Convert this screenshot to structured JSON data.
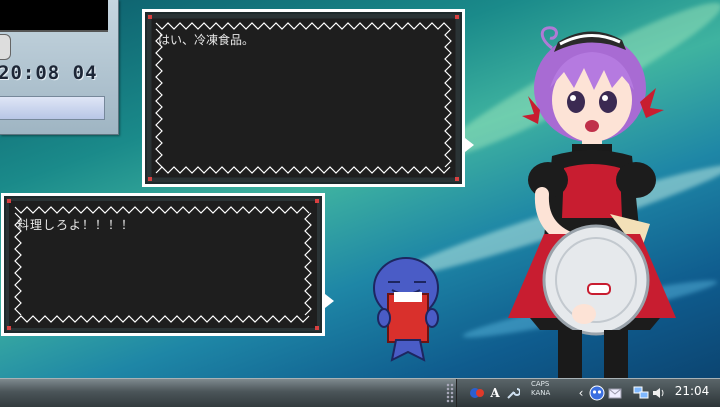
{
  "clock_gadget": {
    "time": "20:08 04"
  },
  "dialogs": {
    "top": {
      "text": "はい、冷凍食品。"
    },
    "bottom": {
      "text": "料理しろよ！！！！"
    }
  },
  "taskbar": {
    "ime": {
      "caps": "CAPS",
      "kana": "KANA"
    },
    "tray_time": "21:04"
  },
  "colors": {
    "dialog_border": "#ffffff",
    "dialog_fill": "#1e1e1e",
    "accent_dot": "#d84040",
    "taskbar": "#3a4346"
  }
}
